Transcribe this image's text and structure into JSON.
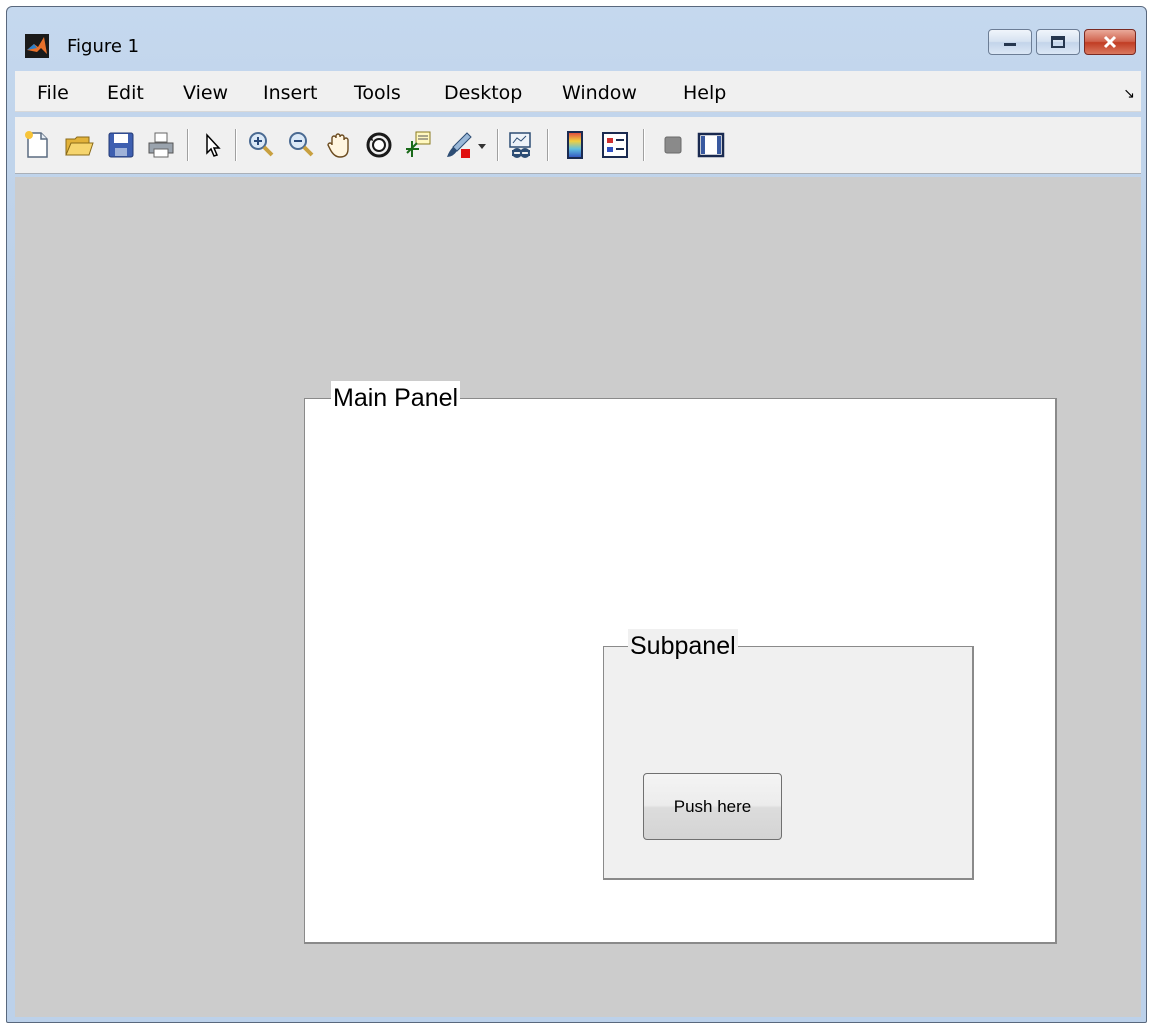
{
  "window": {
    "title": "Figure 1",
    "app_icon": "matlab-logo-icon",
    "caption_buttons": [
      "minimize-icon",
      "maximize-icon",
      "close-icon"
    ]
  },
  "menubar": {
    "items": [
      {
        "label": "File"
      },
      {
        "label": "Edit"
      },
      {
        "label": "View"
      },
      {
        "label": "Insert"
      },
      {
        "label": "Tools"
      },
      {
        "label": "Desktop"
      },
      {
        "label": "Window"
      },
      {
        "label": "Help"
      }
    ],
    "dock_arrow": "↘"
  },
  "toolbar": {
    "buttons": [
      "new-figure-icon",
      "open-file-icon",
      "save-icon",
      "print-icon",
      "edit-plot-arrow-icon",
      "zoom-in-icon",
      "zoom-out-icon",
      "pan-hand-icon",
      "rotate-3d-icon",
      "data-cursor-icon",
      "brush-icon",
      "brush-dropdown-icon",
      "link-plot-icon",
      "insert-colorbar-icon",
      "insert-legend-icon",
      "hide-plot-tools-icon",
      "show-plot-tools-icon"
    ]
  },
  "main_panel": {
    "title": "Main Panel"
  },
  "sub_panel": {
    "title": "Subpanel",
    "button_label": "Push here"
  },
  "colors": {
    "figure_background": "#cccccc",
    "main_panel_background": "#ffffff",
    "sub_panel_background": "#f0f0f0",
    "titlebar": "#bcd1ea"
  }
}
